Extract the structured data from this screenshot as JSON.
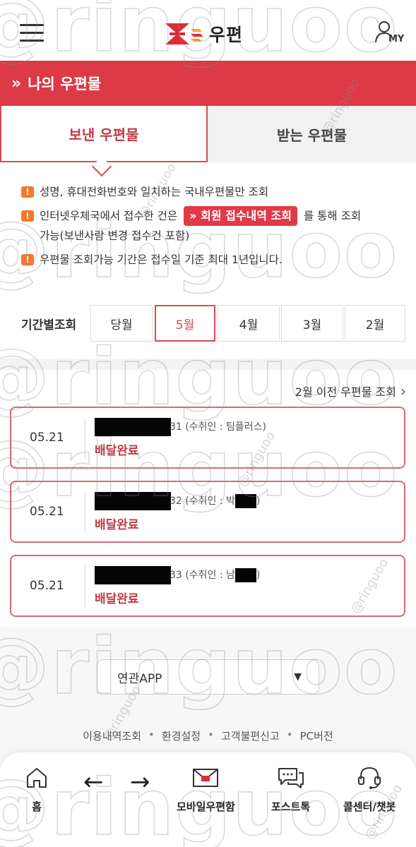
{
  "header": {
    "logo_text": "우편",
    "my_label": "MY",
    "brand_color": "#e02a36"
  },
  "title_bar": {
    "chevron": "»",
    "title": "나의 우편물",
    "bg_color": "#dc3a45"
  },
  "tabs": [
    {
      "label": "보낸 우편물",
      "active": true
    },
    {
      "label": "받는 우편물",
      "active": false
    }
  ],
  "notices": {
    "icon": "!",
    "line1": "성명, 휴대전화번호와 일치하는 국내우편물만 조회",
    "line2_before": "인터넷우체국에서 접수한 건은",
    "line2_link": "» 회원 접수내역 조회",
    "line2_after": "를 통해 조회",
    "line2_cont": "가능(보낸사람 변경 접수건 포함)",
    "line3": "우편물 조회가능 기간은 접수일 기준 최대 1년입니다."
  },
  "period": {
    "label": "기간별조회",
    "options": [
      "당월",
      "5월",
      "4월",
      "3월",
      "2월"
    ],
    "selected": "5월"
  },
  "prev_link": {
    "text": "2월 이전 우편물 조회",
    "chevron": "›"
  },
  "items": [
    {
      "date": "05.21",
      "tracking_suffix": "31",
      "recipient_text": "(수취인 : 팀플러스)",
      "status": "배달완료"
    },
    {
      "date": "05.21",
      "tracking_suffix": "32",
      "recipient_text": "(수취인 : 박",
      "recipient_end": ")",
      "status": "배달완료"
    },
    {
      "date": "05.21",
      "tracking_suffix": "33",
      "recipient_text": "(수취인 : 남",
      "recipient_end": ")",
      "status": "배달완료"
    }
  ],
  "app_select": {
    "value": "연관APP",
    "arrow": "▼"
  },
  "footer_links": [
    "이용내역조회",
    "환경설정",
    "고객불편신고",
    "PC버전"
  ],
  "footer_separator": "•",
  "bottom_nav": {
    "home": "홈",
    "back_arrow": "←",
    "forward_arrow": "→",
    "mailbox": "모바일우편함",
    "posttalk": "포스트톡",
    "callcenter": "콜센터/챗봇"
  },
  "watermark": {
    "text": "@ringuoo"
  }
}
